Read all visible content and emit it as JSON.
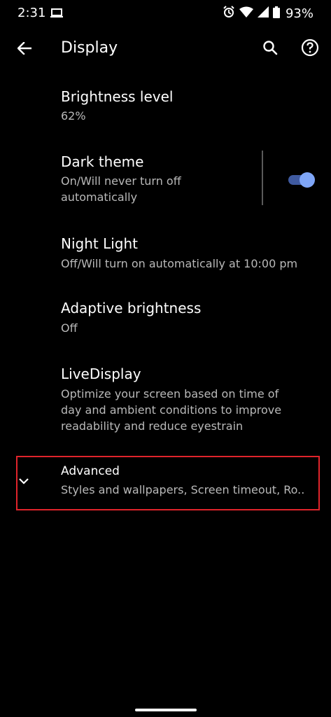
{
  "status_bar": {
    "time": "2:31",
    "battery": "93%",
    "icons": [
      "laptop-icon",
      "alarm-icon",
      "wifi-icon",
      "signal-icon",
      "battery-icon"
    ]
  },
  "app_bar": {
    "title": "Display",
    "back_icon": "back-arrow-icon",
    "search_icon": "search-icon",
    "help_icon": "help-icon"
  },
  "settings": [
    {
      "title": "Brightness level",
      "summary": "62%"
    },
    {
      "title": "Dark theme",
      "summary": "On/Will never turn off\nautomatically",
      "toggle_on": true
    },
    {
      "title": "Night Light",
      "summary": "Off/Will turn on automatically at 10:00 pm"
    },
    {
      "title": "Adaptive brightness",
      "summary": "Off"
    },
    {
      "title": "LiveDisplay",
      "summary": "Optimize your screen based on time of\nday and ambient conditions to improve\nreadability and reduce eyestrain"
    }
  ],
  "advanced": {
    "title": "Advanced",
    "summary": "Styles and wallpapers, Screen timeout, Ro..",
    "chevron_icon": "chevron-down-icon",
    "highlight_color": "#e0242b"
  },
  "colors": {
    "background": "#000000",
    "text_primary": "#ffffff",
    "text_secondary": "#b9b9b9",
    "accent": "#7fa6f7"
  }
}
